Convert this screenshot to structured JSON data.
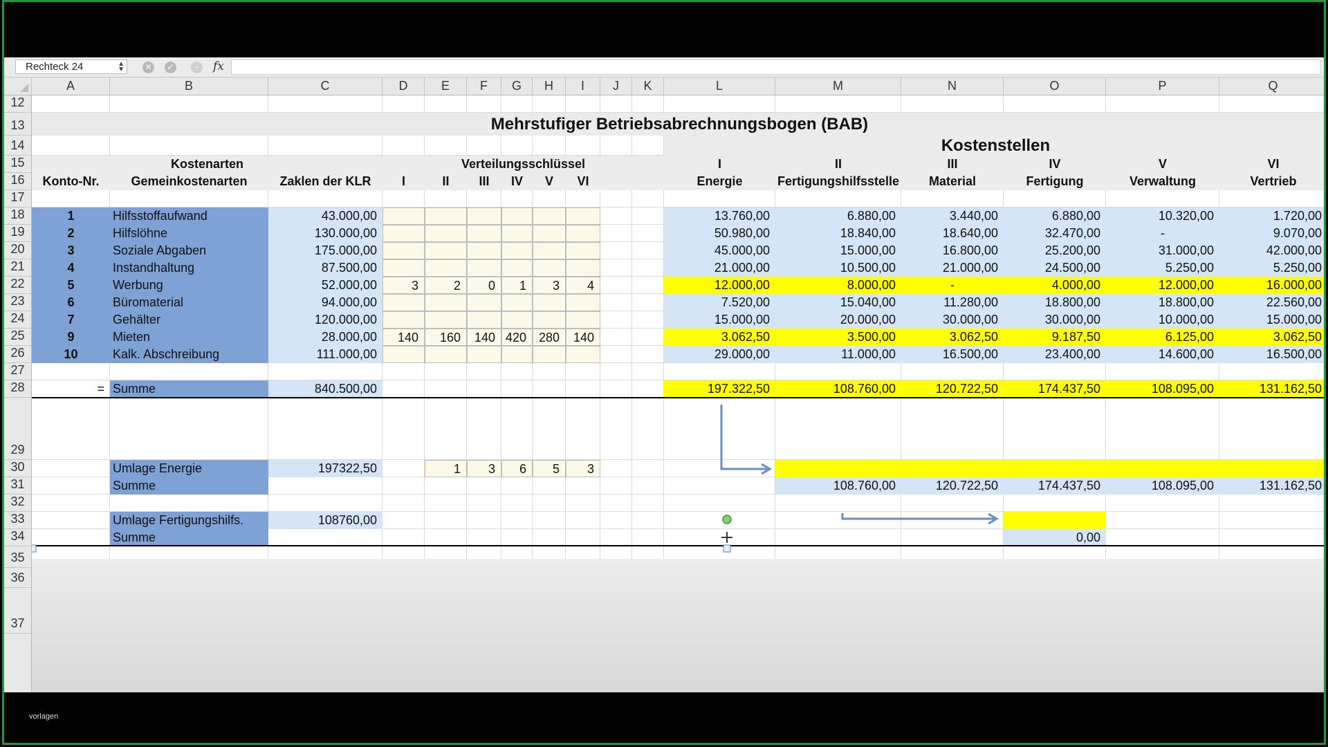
{
  "formula_bar": {
    "name_box": "Rechteck 24",
    "fx_label": "fx"
  },
  "columns": [
    "A",
    "B",
    "C",
    "D",
    "E",
    "F",
    "G",
    "H",
    "I",
    "J",
    "K",
    "L",
    "M",
    "N",
    "O",
    "P",
    "Q"
  ],
  "rows": [
    "12",
    "13",
    "14",
    "15",
    "16",
    "17",
    "18",
    "19",
    "20",
    "21",
    "22",
    "23",
    "24",
    "25",
    "26",
    "27",
    "28",
    "29",
    "30",
    "31",
    "32",
    "33",
    "34",
    "35",
    "36",
    "37"
  ],
  "sheet": {
    "title": "Mehrstufiger Betriebsabrechnungsbogen (BAB)",
    "kostenstellen": "Kostenstellen",
    "hdr15": {
      "kostenarten": "Kostenarten",
      "verteilung": "Verteilungsschlüssel",
      "I": "I",
      "II": "II",
      "III": "III",
      "IV": "IV",
      "V": "V",
      "VI": "VI"
    },
    "hdr16": {
      "konto": "Konto-Nr.",
      "gemein": "Gemeinkostenarten",
      "zahlen": "Zaklen der KLR",
      "I": "I",
      "II": "II",
      "III": "III",
      "IV": "IV",
      "V": "V",
      "VI": "VI",
      "energie": "Energie",
      "fhs": "Fertigungshilfsstelle",
      "material": "Material",
      "fertigung": "Fertigung",
      "verwaltung": "Verwaltung",
      "vertrieb": "Vertrieb"
    },
    "data_rows": [
      {
        "konto": "1",
        "name": "Hilfsstoffaufwand",
        "betrag": "43.000,00",
        "keys": [
          "",
          "",
          "",
          "",
          "",
          ""
        ],
        "ks": [
          "13.760,00",
          "6.880,00",
          "3.440,00",
          "6.880,00",
          "10.320,00",
          "1.720,00"
        ]
      },
      {
        "konto": "2",
        "name": "Hilfslöhne",
        "betrag": "130.000,00",
        "keys": [
          "",
          "",
          "",
          "",
          "",
          ""
        ],
        "ks": [
          "50.980,00",
          "18.840,00",
          "18.640,00",
          "32.470,00",
          "-",
          "9.070,00"
        ]
      },
      {
        "konto": "3",
        "name": "Soziale Abgaben",
        "betrag": "175.000,00",
        "keys": [
          "",
          "",
          "",
          "",
          "",
          ""
        ],
        "ks": [
          "45.000,00",
          "15.000,00",
          "16.800,00",
          "25.200,00",
          "31.000,00",
          "42.000,00"
        ]
      },
      {
        "konto": "4",
        "name": "Instandhaltung",
        "betrag": "87.500,00",
        "keys": [
          "",
          "",
          "",
          "",
          "",
          ""
        ],
        "ks": [
          "21.000,00",
          "10.500,00",
          "21.000,00",
          "24.500,00",
          "5.250,00",
          "5.250,00"
        ]
      },
      {
        "konto": "5",
        "name": "Werbung",
        "betrag": "52.000,00",
        "keys": [
          "3",
          "2",
          "0",
          "1",
          "3",
          "4"
        ],
        "ks": [
          "12.000,00",
          "8.000,00",
          "-",
          "4.000,00",
          "12.000,00",
          "16.000,00"
        ]
      },
      {
        "konto": "6",
        "name": "Büromaterial",
        "betrag": "94.000,00",
        "keys": [
          "",
          "",
          "",
          "",
          "",
          ""
        ],
        "ks": [
          "7.520,00",
          "15.040,00",
          "11.280,00",
          "18.800,00",
          "18.800,00",
          "22.560,00"
        ]
      },
      {
        "konto": "7",
        "name": "Gehälter",
        "betrag": "120.000,00",
        "keys": [
          "",
          "",
          "",
          "",
          "",
          ""
        ],
        "ks": [
          "15.000,00",
          "20.000,00",
          "30.000,00",
          "30.000,00",
          "10.000,00",
          "15.000,00"
        ]
      },
      {
        "konto": "9",
        "name": "Mieten",
        "betrag": "28.000,00",
        "keys": [
          "140",
          "160",
          "140",
          "420",
          "280",
          "140"
        ],
        "ks": [
          "3.062,50",
          "3.500,00",
          "3.062,50",
          "9.187,50",
          "6.125,00",
          "3.062,50"
        ]
      },
      {
        "konto": "10",
        "name": "Kalk. Abschreibung",
        "betrag": "111.000,00",
        "keys": [
          "",
          "",
          "",
          "",
          "",
          ""
        ],
        "ks": [
          "29.000,00",
          "11.000,00",
          "16.500,00",
          "23.400,00",
          "14.600,00",
          "16.500,00"
        ]
      }
    ],
    "summe": {
      "eq": "=",
      "label": "Summe",
      "betrag": "840.500,00",
      "ks": [
        "197.322,50",
        "108.760,00",
        "120.722,50",
        "174.437,50",
        "108.095,00",
        "131.162,50"
      ]
    },
    "umlage_energie": {
      "label": "Umlage Energie",
      "betrag": "197322,50",
      "keys": [
        "1",
        "3",
        "6",
        "5",
        "3"
      ]
    },
    "summe2": {
      "label": "Summe",
      "ks": [
        "108.760,00",
        "120.722,50",
        "174.437,50",
        "108.095,00",
        "131.162,50"
      ]
    },
    "umlage_fhs": {
      "label": "Umlage Fertigungshilfs.",
      "betrag": "108760,00"
    },
    "summe3": {
      "label": "Summe",
      "fertigung": "0,00"
    }
  },
  "watermark": "vorlagen",
  "colors": {
    "blue": "#7fa2d6",
    "light_blue": "#d4e5f7",
    "yellow": "#ffff00",
    "arrow": "#6a8ec6"
  }
}
